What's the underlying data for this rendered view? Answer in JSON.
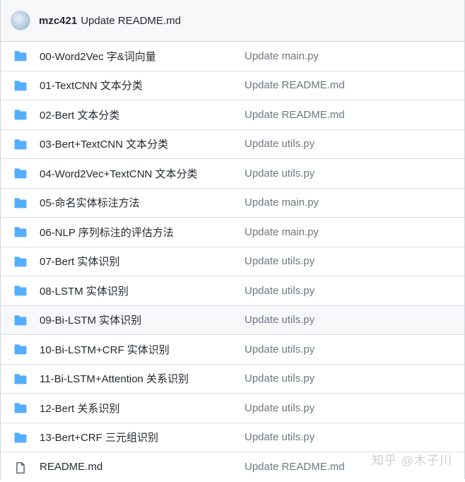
{
  "header": {
    "author": "mzc421",
    "message": "Update README.md"
  },
  "files": [
    {
      "type": "folder",
      "name": "00-Word2Vec 字&词向量",
      "commit": "Update main.py"
    },
    {
      "type": "folder",
      "name": "01-TextCNN 文本分类",
      "commit": "Update README.md"
    },
    {
      "type": "folder",
      "name": "02-Bert 文本分类",
      "commit": "Update README.md"
    },
    {
      "type": "folder",
      "name": "03-Bert+TextCNN 文本分类",
      "commit": "Update utils.py"
    },
    {
      "type": "folder",
      "name": "04-Word2Vec+TextCNN 文本分类",
      "commit": "Update utils.py"
    },
    {
      "type": "folder",
      "name": "05-命名实体标注方法",
      "commit": "Update main.py"
    },
    {
      "type": "folder",
      "name": "06-NLP 序列标注的评估方法",
      "commit": "Update main.py"
    },
    {
      "type": "folder",
      "name": "07-Bert 实体识别",
      "commit": "Update utils.py"
    },
    {
      "type": "folder",
      "name": "08-LSTM 实体识别",
      "commit": "Update utils.py"
    },
    {
      "type": "folder",
      "name": "09-Bi-LSTM 实体识别",
      "commit": "Update utils.py"
    },
    {
      "type": "folder",
      "name": "10-Bi-LSTM+CRF 实体识别",
      "commit": "Update utils.py"
    },
    {
      "type": "folder",
      "name": "11-Bi-LSTM+Attention 关系识别",
      "commit": "Update utils.py"
    },
    {
      "type": "folder",
      "name": "12-Bert 关系识别",
      "commit": "Update utils.py"
    },
    {
      "type": "folder",
      "name": "13-Bert+CRF 三元组识别",
      "commit": "Update utils.py"
    },
    {
      "type": "file",
      "name": "README.md",
      "commit": "Update README.md"
    }
  ],
  "watermark": "知乎 @木子川",
  "colors": {
    "folder_icon": "#54aeff",
    "file_icon": "#57606a",
    "hover_row": "#f6f8fa",
    "commit_text": "#6e7781"
  }
}
